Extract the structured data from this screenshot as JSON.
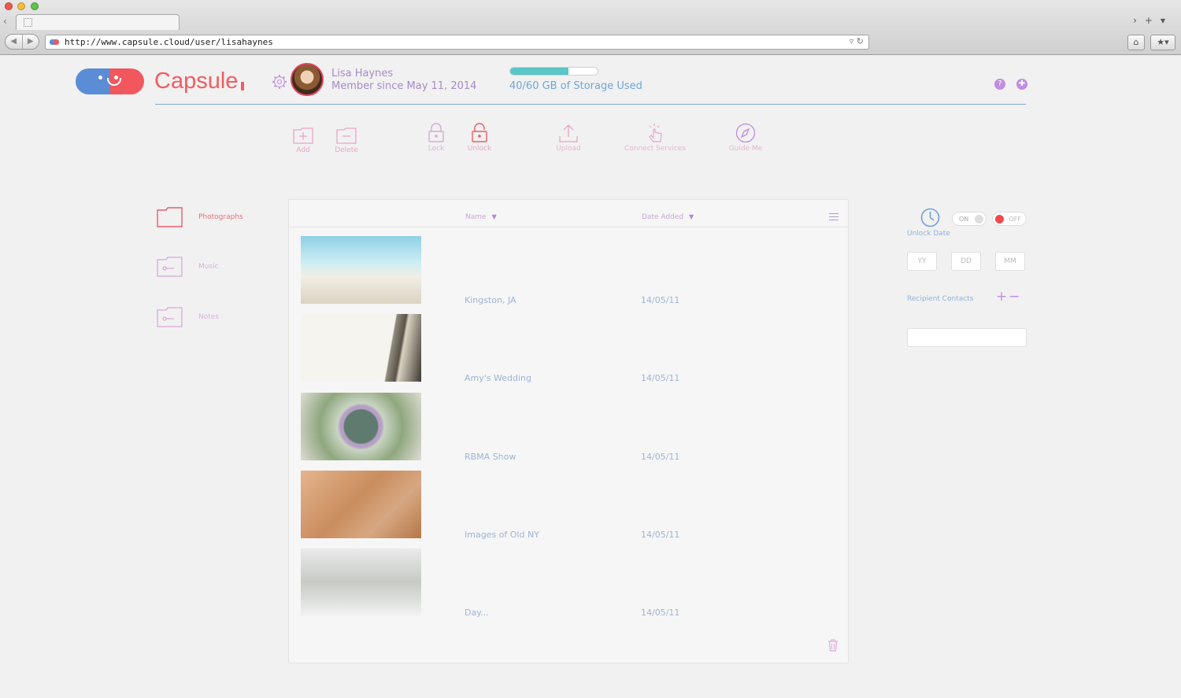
{
  "browser": {
    "url": "http://www.capsule.cloud/user/lisahaynes"
  },
  "app": {
    "brand": "Capsule",
    "user_name": "Lisa Haynes",
    "member_since": "Member since May 11, 2014",
    "storage_text": "40/60 GB of Storage Used",
    "storage_used_fraction": 0.667
  },
  "toolbar": {
    "add": "Add",
    "delete": "Delete",
    "lock": "Lock",
    "unlock": "Unlock",
    "upload": "Upload",
    "connect": "Connect Services",
    "guide": "Guide Me"
  },
  "folders": [
    {
      "label": "Photographs"
    },
    {
      "label": "Music"
    },
    {
      "label": "Notes"
    }
  ],
  "table": {
    "col_name": "Name",
    "col_date": "Date Added",
    "rows": [
      {
        "name": "Kingston, JA",
        "date": "14/05/11"
      },
      {
        "name": "Amy's Wedding",
        "date": "14/05/11"
      },
      {
        "name": "RBMA Show",
        "date": "14/05/11"
      },
      {
        "name": "Images of Old NY",
        "date": "14/05/11"
      },
      {
        "name": "Day...",
        "date": "14/05/11"
      }
    ]
  },
  "settings": {
    "unlock_date": "Unlock Date",
    "on": "ON",
    "off": "OFF",
    "yy": "YY",
    "dd": "DD",
    "mm": "MM",
    "recipient_contacts": "Recipient Contacts"
  },
  "colors": {
    "brand_red": "#f25c60",
    "brand_blue": "#5a8dd6",
    "accent_purple": "#c08de0",
    "storage_fill": "#59c6c7"
  }
}
